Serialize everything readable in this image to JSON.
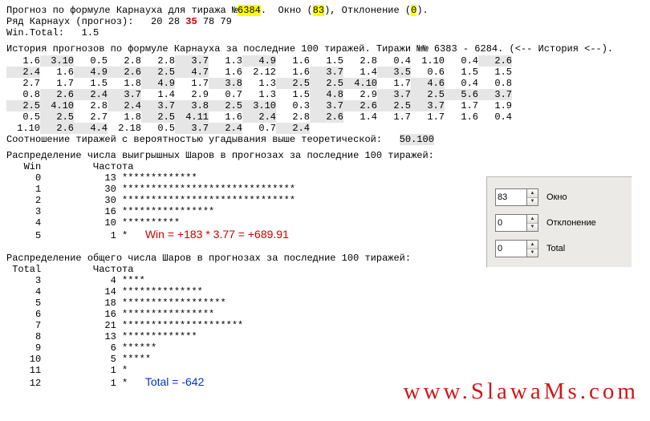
{
  "header": {
    "prefix1": "Прогноз по формуле Карнауха для тиража №",
    "draw_no": "6384",
    "prefix2": ".  Окно (",
    "window": "83",
    "prefix3": "), Отклонение (",
    "deviation": "0",
    "prefix4": ")."
  },
  "forecast_row": {
    "label": "Ряд Карнаух (прогноз):   ",
    "n1": "20",
    "n2": "28",
    "n3": "35",
    "n4": "78",
    "n5": "79"
  },
  "win_total_line": "Win.Total:   1.5",
  "history_header": "История прогнозов по формуле Карнауха за последние 100 тиражей. Тиражи №№ 6383 - 6284. (<-- История <--).",
  "history": {
    "cols": 15,
    "rows": [
      [
        [
          "1.6",
          0
        ],
        [
          "3.10",
          1
        ],
        [
          "0.5",
          0
        ],
        [
          "2.8",
          0
        ],
        [
          "2.8",
          0
        ],
        [
          "3.7",
          1
        ],
        [
          "1.3",
          0
        ],
        [
          "4.9",
          1
        ],
        [
          "1.6",
          0
        ],
        [
          "1.5",
          0
        ],
        [
          "2.8",
          0
        ],
        [
          "0.4",
          0
        ],
        [
          "1.10",
          0
        ],
        [
          "0.4",
          0
        ],
        [
          "2.6",
          1
        ]
      ],
      [
        [
          "2.4",
          1
        ],
        [
          "1.6",
          0
        ],
        [
          "4.9",
          1
        ],
        [
          "2.6",
          1
        ],
        [
          "2.5",
          1
        ],
        [
          "4.7",
          1
        ],
        [
          "1.6",
          0
        ],
        [
          "2.12",
          0
        ],
        [
          "1.6",
          0
        ],
        [
          "3.7",
          1
        ],
        [
          "1.4",
          0
        ],
        [
          "3.5",
          1
        ],
        [
          "0.6",
          0
        ],
        [
          "1.5",
          0
        ],
        [
          "1.5",
          0
        ]
      ],
      [
        [
          "2.7",
          0
        ],
        [
          "1.7",
          0
        ],
        [
          "1.5",
          0
        ],
        [
          "1.8",
          0
        ],
        [
          "4.9",
          1
        ],
        [
          "1.7",
          0
        ],
        [
          "3.8",
          1
        ],
        [
          "1.3",
          0
        ],
        [
          "2.5",
          1
        ],
        [
          "2.5",
          1
        ],
        [
          "4.10",
          1
        ],
        [
          "1.7",
          0
        ],
        [
          "4.6",
          1
        ],
        [
          "0.4",
          0
        ],
        [
          "0.8",
          0
        ]
      ],
      [
        [
          "0.8",
          0
        ],
        [
          "2.6",
          1
        ],
        [
          "2.4",
          1
        ],
        [
          "3.7",
          1
        ],
        [
          "1.4",
          0
        ],
        [
          "2.9",
          0
        ],
        [
          "0.7",
          0
        ],
        [
          "1.3",
          0
        ],
        [
          "1.5",
          0
        ],
        [
          "4.8",
          1
        ],
        [
          "2.9",
          0
        ],
        [
          "3.7",
          1
        ],
        [
          "2.5",
          1
        ],
        [
          "5.6",
          1
        ],
        [
          "3.7",
          1
        ]
      ],
      [
        [
          "2.5",
          1
        ],
        [
          "4.10",
          1
        ],
        [
          "2.8",
          0
        ],
        [
          "2.4",
          1
        ],
        [
          "3.7",
          1
        ],
        [
          "3.8",
          1
        ],
        [
          "2.5",
          1
        ],
        [
          "3.10",
          1
        ],
        [
          "0.3",
          0
        ],
        [
          "3.7",
          1
        ],
        [
          "2.6",
          1
        ],
        [
          "2.5",
          1
        ],
        [
          "3.7",
          1
        ],
        [
          "1.7",
          0
        ],
        [
          "1.9",
          0
        ]
      ],
      [
        [
          "0.5",
          0
        ],
        [
          "2.5",
          1
        ],
        [
          "2.7",
          0
        ],
        [
          "1.8",
          0
        ],
        [
          "2.5",
          1
        ],
        [
          "4.11",
          1
        ],
        [
          "1.6",
          0
        ],
        [
          "2.4",
          1
        ],
        [
          "2.8",
          0
        ],
        [
          "2.6",
          1
        ],
        [
          "1.4",
          0
        ],
        [
          "1.7",
          0
        ],
        [
          "1.7",
          0
        ],
        [
          "1.6",
          0
        ],
        [
          "0.4",
          0
        ]
      ],
      [
        [
          "1.10",
          0
        ],
        [
          "2.6",
          1
        ],
        [
          "4.4",
          1
        ],
        [
          "2.18",
          0
        ],
        [
          "0.5",
          0
        ],
        [
          "3.7",
          1
        ],
        [
          "2.4",
          1
        ],
        [
          "0.7",
          0
        ],
        [
          "2.4",
          1
        ],
        [
          "",
          0
        ],
        [
          "",
          0
        ],
        [
          "",
          0
        ],
        [
          "",
          0
        ],
        [
          "",
          0
        ],
        [
          "",
          0
        ]
      ]
    ]
  },
  "match_line_prefix": "Соотношение тиражей с вероятностью угадывания выше теоретической:   ",
  "match_value": "50.100",
  "dist_win_header": "Распределение числа выигрышных Шаров в прогнозах за последние 100 тиражей:",
  "dist_win_cols": "   Win         Частота",
  "dist_win": [
    {
      "k": "0",
      "f": "13",
      "bar": "*************"
    },
    {
      "k": "1",
      "f": "30",
      "bar": "******************************"
    },
    {
      "k": "2",
      "f": "30",
      "bar": "******************************"
    },
    {
      "k": "3",
      "f": "16",
      "bar": "****************"
    },
    {
      "k": "4",
      "f": "10",
      "bar": "**********"
    },
    {
      "k": "5",
      "f": "1",
      "bar": "*"
    }
  ],
  "win_formula": "Win = +183 * 3.77 = +689.91",
  "dist_total_header": "Распределение общего числа Шаров в прогнозах за последние 100 тиражей:",
  "dist_total_cols": " Total         Частота",
  "dist_total": [
    {
      "k": "3",
      "f": "4",
      "bar": "****"
    },
    {
      "k": "4",
      "f": "14",
      "bar": "**************"
    },
    {
      "k": "5",
      "f": "18",
      "bar": "******************"
    },
    {
      "k": "6",
      "f": "16",
      "bar": "****************"
    },
    {
      "k": "7",
      "f": "21",
      "bar": "*********************"
    },
    {
      "k": "8",
      "f": "13",
      "bar": "*************"
    },
    {
      "k": "9",
      "f": "6",
      "bar": "******"
    },
    {
      "k": "10",
      "f": "5",
      "bar": "*****"
    },
    {
      "k": "11",
      "f": "1",
      "bar": "*"
    },
    {
      "k": "12",
      "f": "1",
      "bar": "*"
    }
  ],
  "total_formula": "Total = -642",
  "panel": {
    "window_label": "Окно",
    "window_value": "83",
    "deviation_label": "Отклонение",
    "deviation_value": "0",
    "total_label": "Total",
    "total_value": "0"
  },
  "watermark": "www.SlawaMs.com"
}
